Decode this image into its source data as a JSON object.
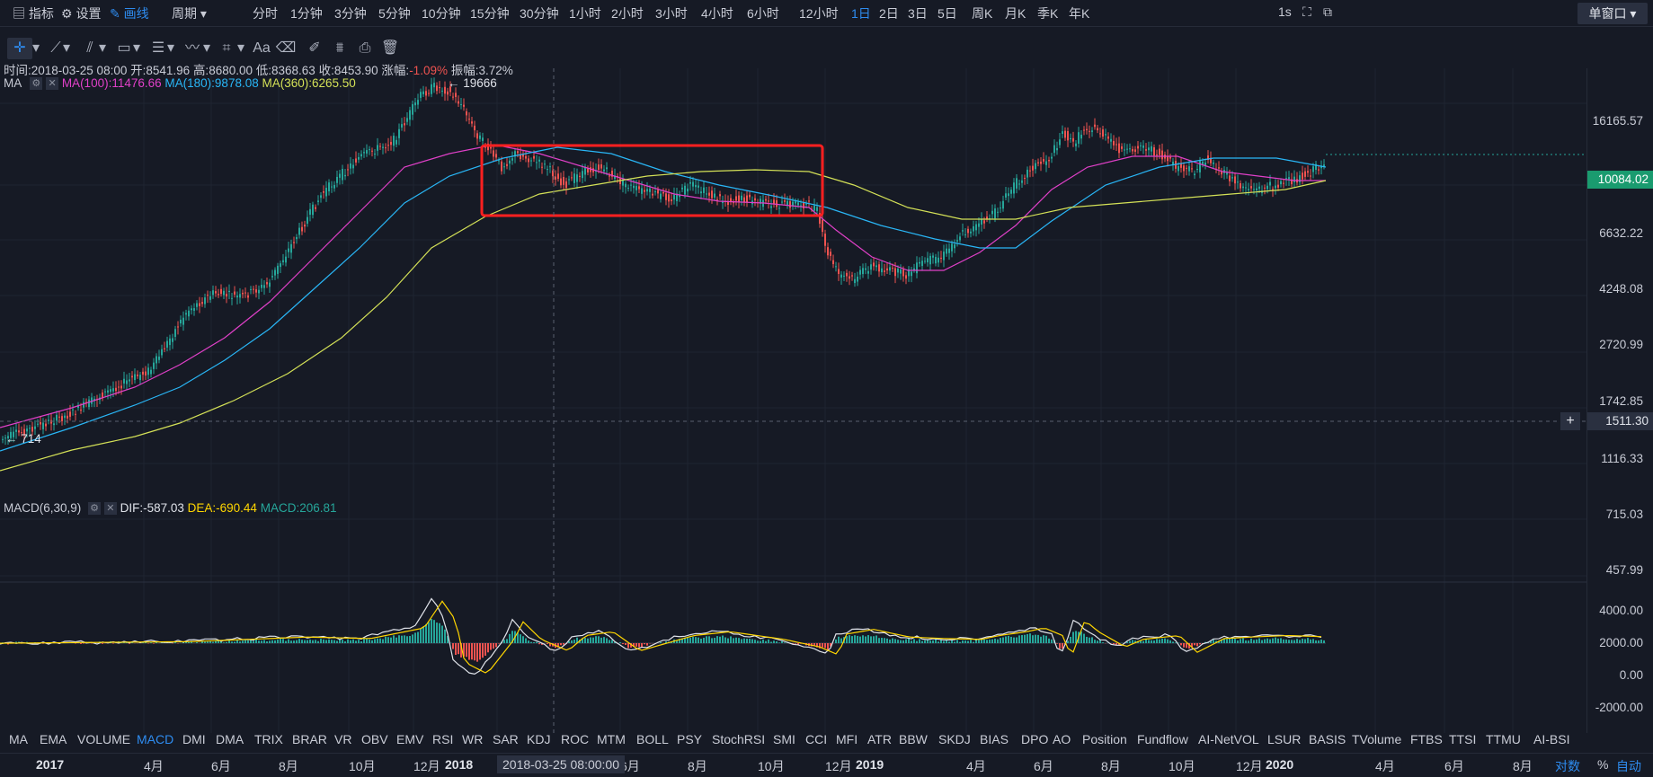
{
  "topbar": {
    "indicator": "指标",
    "settings": "设置",
    "draw": "画线",
    "period": "周期",
    "periods": [
      "分时",
      "1分钟",
      "3分钟",
      "5分钟",
      "10分钟",
      "15分钟",
      "30分钟",
      "1小时",
      "2小时",
      "3小时",
      "4小时",
      "6小时",
      "12小时",
      "1日",
      "2日",
      "3日",
      "5日",
      "周K",
      "月K",
      "季K",
      "年K"
    ],
    "active_period": "1日",
    "interval": "1s",
    "window_mode": "单窗口"
  },
  "drawbar": {
    "text_tool": "Aa"
  },
  "ohlc": {
    "time": "时间:2018-03-25 08:00",
    "open": "开:8541.96",
    "high": "高:8680.00",
    "low": "低:8368.63",
    "close": "收:8453.90",
    "change_label": "涨幅:",
    "change": "-1.09%",
    "amplitude": "振幅:3.72%"
  },
  "ma_legend": {
    "name": "MA",
    "ma100": "MA(100):11476.66",
    "ma180": "MA(180):9878.08",
    "ma360": "MA(360):6265.50"
  },
  "annotations": {
    "peak": "← 19666",
    "low": "← 714"
  },
  "price_axis": [
    "16165.57",
    "6632.22",
    "4248.08",
    "2720.99",
    "1742.85",
    "1116.33",
    "715.03",
    "457.99"
  ],
  "current_price": "10084.02",
  "crosshair_price": "1511.30",
  "macd_legend": {
    "name": "MACD(6,30,9)",
    "dif": "DIF:-587.03",
    "dea": "DEA:-690.44",
    "macd": "MACD:206.81"
  },
  "macd_axis": [
    "4000.00",
    "2000.00",
    "0.00",
    "-2000.00"
  ],
  "indicators": [
    "MA",
    "EMA",
    "VOLUME",
    "MACD",
    "DMI",
    "DMA",
    "TRIX",
    "BRAR",
    "VR",
    "OBV",
    "EMV",
    "RSI",
    "WR",
    "SAR",
    "KDJ",
    "ROC",
    "MTM",
    "BOLL",
    "PSY",
    "StochRSI",
    "SMI",
    "CCI",
    "MFI",
    "ATR",
    "BBW",
    "SKDJ",
    "BIAS",
    "DPO",
    "AO",
    "Position",
    "Fundflow",
    "AI-NetVOL",
    "LSUR",
    "BASIS",
    "TVolume",
    "FTBS",
    "TTSI",
    "TTMU",
    "AI-BSI"
  ],
  "active_indicator": "MACD",
  "time_axis": [
    "2017",
    "4月",
    "6月",
    "8月",
    "10月",
    "12月",
    "2018",
    "2018-03-25 08:00:00",
    "6月",
    "8月",
    "10月",
    "12月",
    "2019",
    "4月",
    "6月",
    "8月",
    "10月",
    "12月",
    "2020",
    "4月",
    "6月",
    "8月"
  ],
  "scale_modes": {
    "log": "对数",
    "percent": "%",
    "auto": "自动"
  },
  "colors": {
    "up": "#26a69a",
    "down": "#ef5350",
    "ma100": "#e040c8",
    "ma180": "#29b6f6",
    "ma360": "#d4e157",
    "accent": "#2e8cf0",
    "highlight_box": "#ff2020"
  }
}
